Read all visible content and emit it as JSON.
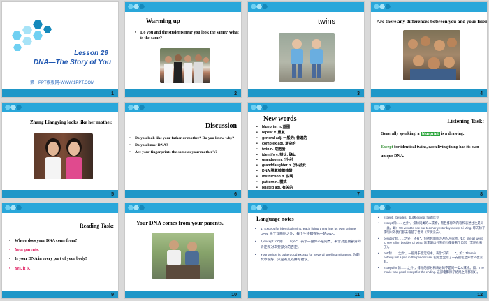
{
  "slides": [
    {
      "num": "1",
      "lesson": "Lesson 29",
      "title": "DNA—The Story of You",
      "footer": "第一PPT模板网-WWW.1PPT.COM"
    },
    {
      "num": "2",
      "heading": "Warming up",
      "bullet": "Do you and the students near you look the same? What is the same?"
    },
    {
      "num": "3",
      "heading": "twins"
    },
    {
      "num": "4",
      "heading": "Are there any differences between you and your friends?"
    },
    {
      "num": "5",
      "heading": "Zhang Liangying looks like her mother."
    },
    {
      "num": "6",
      "heading": "Discussion",
      "bullets": [
        "Do you look like your father or mother? Do you know why?",
        "Do you know DNA?",
        "Are your fingerprints the same as your mother's?"
      ]
    },
    {
      "num": "7",
      "heading": "New words",
      "items": [
        "blueprint  n. 蓝图",
        "repeat v. 重复",
        "general  adj. 一般的; 普遍的",
        "complex adj. 复杂的",
        "twin  n.  双胞胎",
        "identify  v. 辨认; 确认",
        "grandson n. (外)孙",
        "granddaughter n. (外)孙女",
        "DNA 脱氧核糖核酸",
        "instruction n. 说明",
        "pattern n. 模式",
        "related adj. 有关的"
      ]
    },
    {
      "num": "8",
      "heading": "Listening Task:",
      "line1_pre": "Generally speaking, a ",
      "line1_ans": "blueprint",
      "line1_post": " is a drawing.",
      "line2_ans": "Except",
      "line2_post": " for identical twins, each living thing has its own unique DNA."
    },
    {
      "num": "9",
      "heading": "Reading Task:",
      "q1": "Where does your DNA come from?",
      "a1": "Your parents.",
      "q2": "Is your DNA in every part of your body?",
      "a2": "Yes, it is."
    },
    {
      "num": "10",
      "heading": "Your DNA comes from your parents."
    },
    {
      "num": "11",
      "heading": "Language notes",
      "notes": [
        "1. Except for identical twins, each living thing has its own unique DAN. 除了双胞胎之外，每个生物都有独一的DNA。",
        "1)except for“除……以外”，表示一整体不是同类，表示对主要部分的肯定和对次要部分的否定。",
        "Your article is quite good except for several spelling mistakes. 你的文章很好，只是有几处拼写错误。"
      ]
    },
    {
      "num": "12",
      "notes": [
        "except、besides、but和except for的区别",
        "except“除……之外”，排除同类的人或物，而且排除的内容和表述往往是同一类。如：We went to see our teacher yesterday except Li Ming. 昨天除了李明以外我们都去看望了老师（李明没去）。",
        "besides“除……之外，还有”，包括后面所涉及的人或物。如：We all went to see a film besides Li Ming. 除李明以外我们也都去看了电影（李明也去了）。",
        "but“除……之外”，一般用于否定句中，表示“只有……”。如：There is nothing but a pen in the pencil case. 铅笔盒里除了一支钢笔之外什么也没有。",
        "except for“除……之外”，排除的部分和表述的不是同一类人或物。如：The movie was good except for the ending. 这部电影除了结尾之外都很好。"
      ]
    }
  ]
}
